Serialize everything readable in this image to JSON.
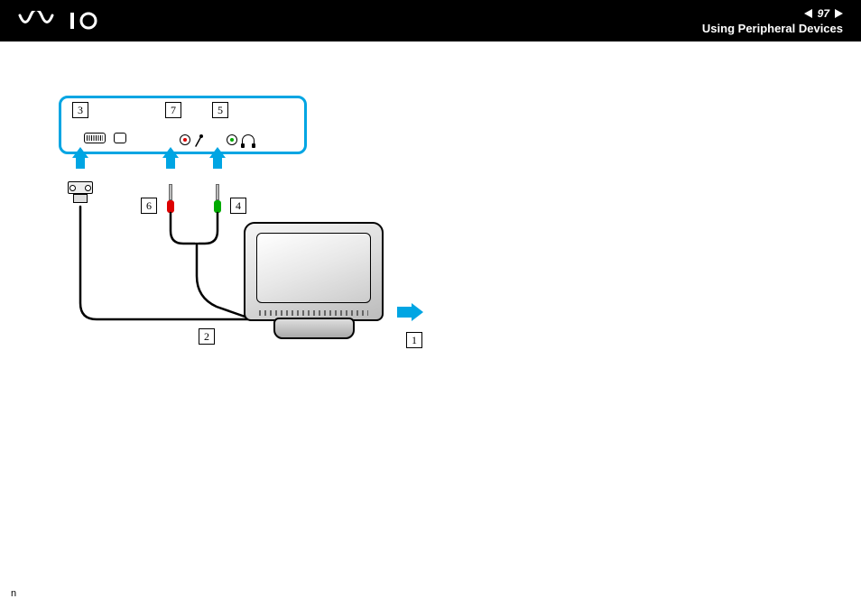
{
  "header": {
    "page_number": "97",
    "section_title": "Using Peripheral Devices",
    "brand": "VAIO"
  },
  "callouts": {
    "c1": "1",
    "c2": "2",
    "c3": "3",
    "c4": "4",
    "c5": "5",
    "c6": "6",
    "c7": "7"
  },
  "footer": {
    "letter": "n"
  }
}
